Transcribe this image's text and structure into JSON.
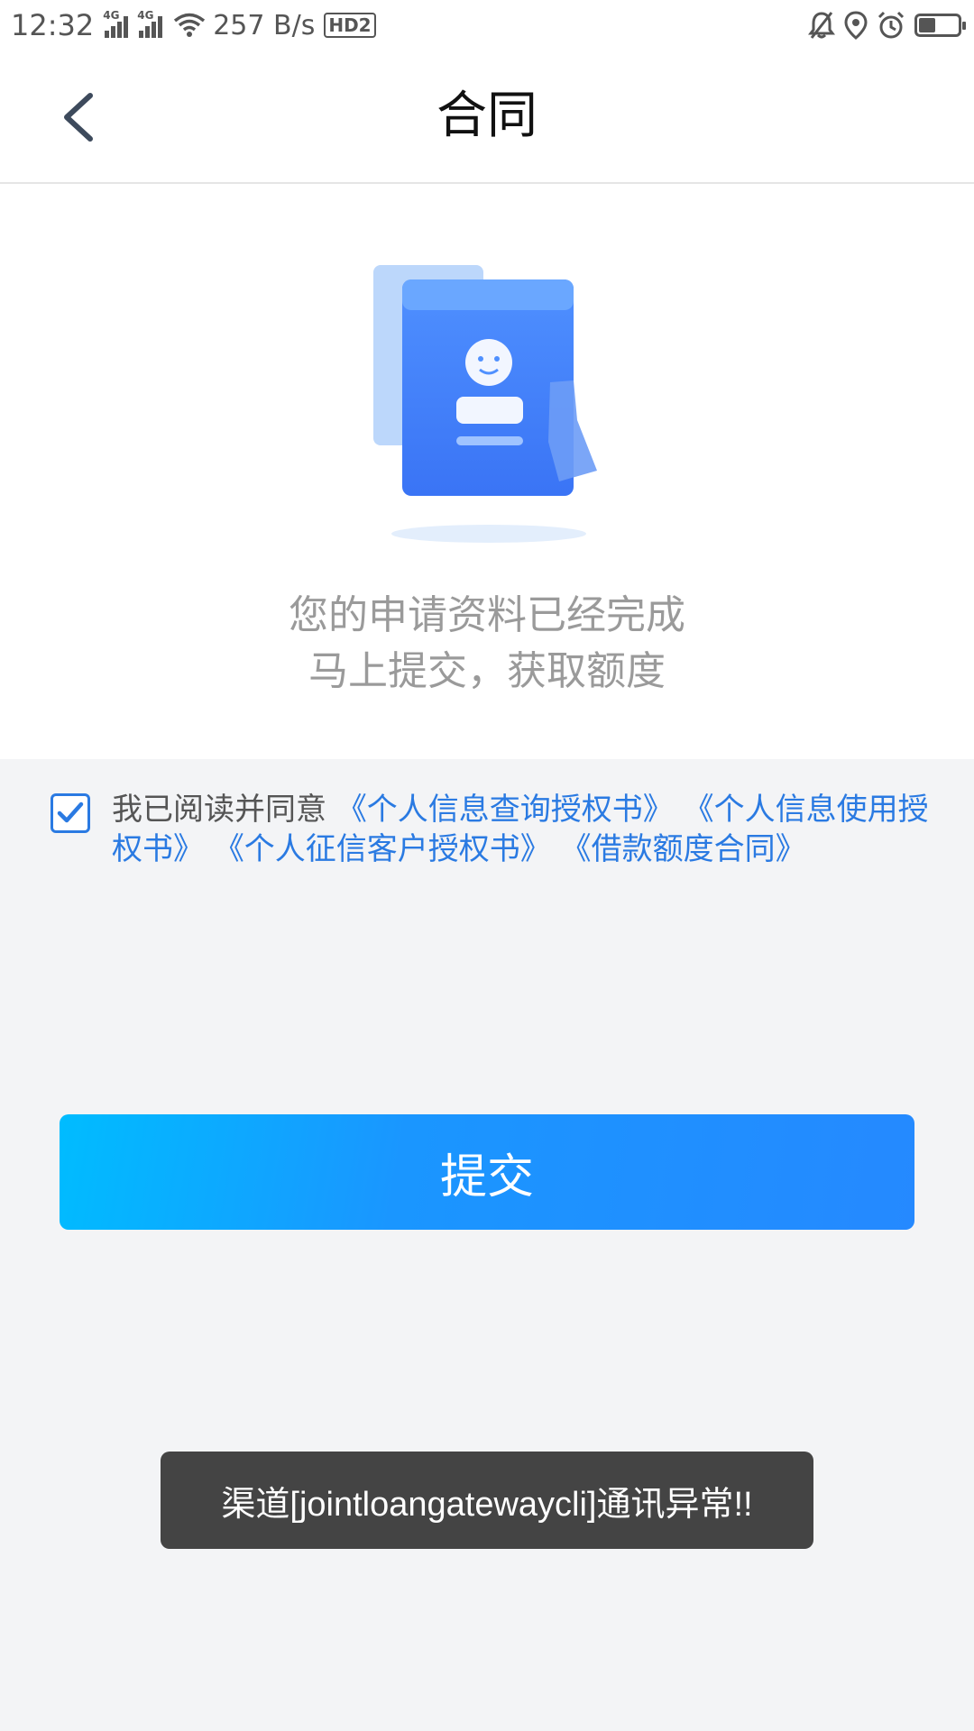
{
  "status_bar": {
    "time": "12:32",
    "signal1_tag": "4G",
    "signal2_tag": "4G",
    "network_speed": "257 B/s",
    "hd_badge": "HD2",
    "icons": [
      "bell-off-icon",
      "location-icon",
      "alarm-icon",
      "battery-icon"
    ],
    "battery_level": 0.4
  },
  "header": {
    "title": "合同",
    "back_icon": "chevron-left-icon"
  },
  "main": {
    "illustration_icon": "contract-profile-icon",
    "message_line1": "您的申请资料已经完成",
    "message_line2": "马上提交，获取额度"
  },
  "agreement": {
    "checked": true,
    "prefix": "我已阅读并同意",
    "links": [
      "《个人信息查询授权书》",
      "《个人信息使用授权书》",
      "《个人征信客户授权书》",
      "《借款额度合同》"
    ]
  },
  "submit": {
    "label": "提交"
  },
  "toast": {
    "message": "渠道[jointloangatewaycli]通讯异常!!"
  },
  "colors": {
    "accent": "#2a7ae2",
    "button_gradient_start": "#00bcff",
    "button_gradient_end": "#2589ff",
    "toast_bg": "#444444"
  }
}
